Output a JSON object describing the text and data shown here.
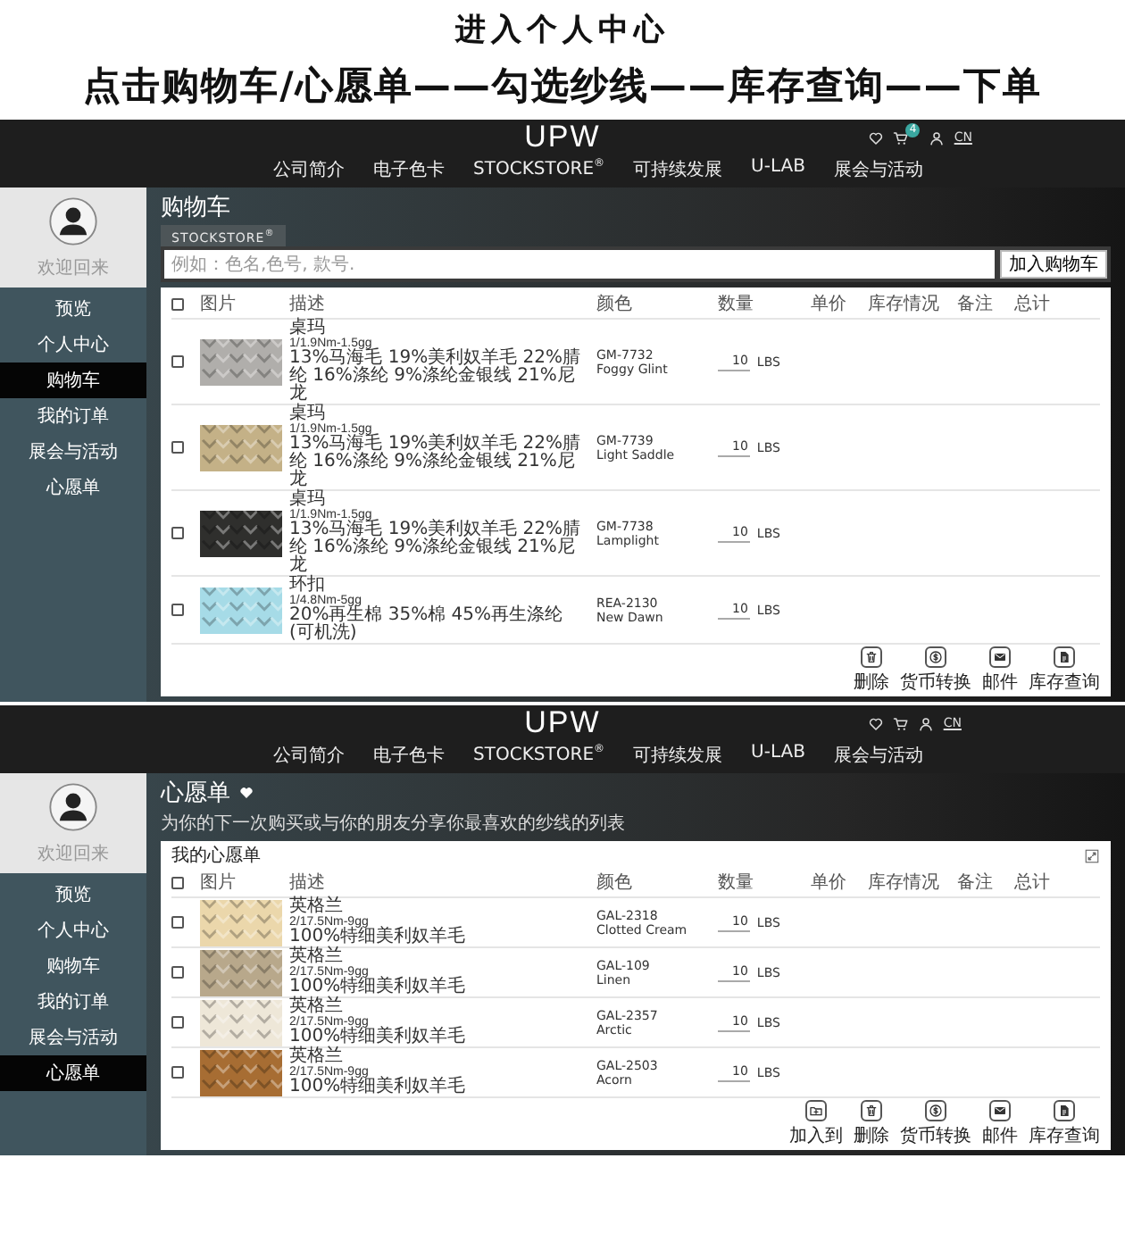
{
  "heading": {
    "title": "进入个人中心",
    "steps": "点击购物车/心愿单——勾选纱线——库存查询——下单"
  },
  "screens": [
    {
      "kind": "cart",
      "header": {
        "logo": "UPW",
        "cart_count": "4",
        "language": "CN",
        "nav": [
          "公司简介",
          "电子色卡",
          "STOCKSTORE$^{®}$",
          "可持续发展",
          "U-LAB",
          "展会与活动"
        ]
      },
      "sidebar": {
        "greeting": "欢迎回来",
        "items": [
          {
            "label": "预览",
            "selected": false
          },
          {
            "label": "个人中心",
            "selected": false
          },
          {
            "label": "购物车",
            "selected": true
          },
          {
            "label": "我的订单",
            "selected": false
          },
          {
            "label": "展会与活动",
            "selected": false
          },
          {
            "label": "心愿单",
            "selected": false
          }
        ]
      },
      "title": "购物车",
      "store_tab": "STOCKSTORE$^{®}$",
      "search": {
        "placeholder": "例如：色名,色号, 款号."
      },
      "add_button": "加入购物车",
      "table": {
        "all_checked": false,
        "columns": [
          "图片",
          "描述",
          "颜色",
          "数量",
          "单价",
          "库存情况",
          "备注",
          "总计"
        ],
        "rows": [
          {
            "checked": false,
            "name": "桌玛",
            "spec": "1/1.9Nm-1.5gg",
            "composition": "13%马海毛 19%美利奴羊毛 22%腈纶 16%涤纶 9%涤纶金银线 21%尼龙",
            "code": "GM-7732",
            "color_name": "Foggy Glint",
            "quantity": "10",
            "unit": "LBS"
          },
          {
            "checked": false,
            "name": "桌玛",
            "spec": "1/1.9Nm-1.5gg",
            "composition": "13%马海毛 19%美利奴羊毛 22%腈纶 16%涤纶 9%涤纶金银线 21%尼龙",
            "code": "GM-7739",
            "color_name": "Light Saddle",
            "quantity": "10",
            "unit": "LBS"
          },
          {
            "checked": false,
            "name": "桌玛",
            "spec": "1/1.9Nm-1.5gg",
            "composition": "13%马海毛 19%美利奴羊毛 22%腈纶 16%涤纶 9%涤纶金银线 21%尼龙",
            "code": "GM-7738",
            "color_name": "Lamplight",
            "quantity": "10",
            "unit": "LBS"
          },
          {
            "checked": false,
            "name": "环扣",
            "spec": "1/4.8Nm-5gg",
            "composition": "20%再生棉 35%棉 45%再生涤纶 (可机洗)",
            "code": "REA-2130",
            "color_name": "New Dawn",
            "quantity": "10",
            "unit": "LBS"
          }
        ]
      },
      "actions": [
        {
          "kind": "delete",
          "label": "删除"
        },
        {
          "kind": "currency",
          "label": "货币转换"
        },
        {
          "kind": "mail",
          "label": "邮件"
        },
        {
          "kind": "stock",
          "label": "库存查询"
        }
      ]
    },
    {
      "kind": "wishlist",
      "header": {
        "logo": "UPW",
        "language": "CN",
        "nav": [
          "公司简介",
          "电子色卡",
          "STOCKSTORE$^{®}$",
          "可持续发展",
          "U-LAB",
          "展会与活动"
        ]
      },
      "sidebar": {
        "greeting": "欢迎回来",
        "items": [
          {
            "label": "预览",
            "selected": false
          },
          {
            "label": "个人中心",
            "selected": false
          },
          {
            "label": "购物车",
            "selected": false
          },
          {
            "label": "我的订单",
            "selected": false
          },
          {
            "label": "展会与活动",
            "selected": false
          },
          {
            "label": "心愿单",
            "selected": true
          }
        ]
      },
      "title": "心愿单",
      "subtitle": "为你的下一次购买或与你的朋友分享你最喜欢的纱线的列表",
      "list_label": "我的心愿单",
      "table": {
        "all_checked": false,
        "columns": [
          "图片",
          "描述",
          "颜色",
          "数量",
          "单价",
          "库存情况",
          "备注",
          "总计"
        ],
        "rows": [
          {
            "checked": false,
            "name": "英格兰",
            "spec": "2/17.5Nm-9gg",
            "composition": "100%特细美利奴羊毛",
            "code": "GAL-2318",
            "color_name": "Clotted Cream",
            "quantity": "10",
            "unit": "LBS"
          },
          {
            "checked": false,
            "name": "英格兰",
            "spec": "2/17.5Nm-9gg",
            "composition": "100%特细美利奴羊毛",
            "code": "GAL-109",
            "color_name": "Linen",
            "quantity": "10",
            "unit": "LBS"
          },
          {
            "checked": false,
            "name": "英格兰",
            "spec": "2/17.5Nm-9gg",
            "composition": "100%特细美利奴羊毛",
            "code": "GAL-2357",
            "color_name": "Arctic",
            "quantity": "10",
            "unit": "LBS"
          },
          {
            "checked": false,
            "name": "英格兰",
            "spec": "2/17.5Nm-9gg",
            "composition": "100%特细美利奴羊毛",
            "code": "GAL-2503",
            "color_name": "Acorn",
            "quantity": "10",
            "unit": "LBS"
          }
        ]
      },
      "actions": [
        {
          "kind": "add",
          "label": "加入到"
        },
        {
          "kind": "delete",
          "label": "删除"
        },
        {
          "kind": "currency",
          "label": "货币转换"
        },
        {
          "kind": "mail",
          "label": "邮件"
        },
        {
          "kind": "stock",
          "label": "库存查询"
        }
      ]
    }
  ]
}
